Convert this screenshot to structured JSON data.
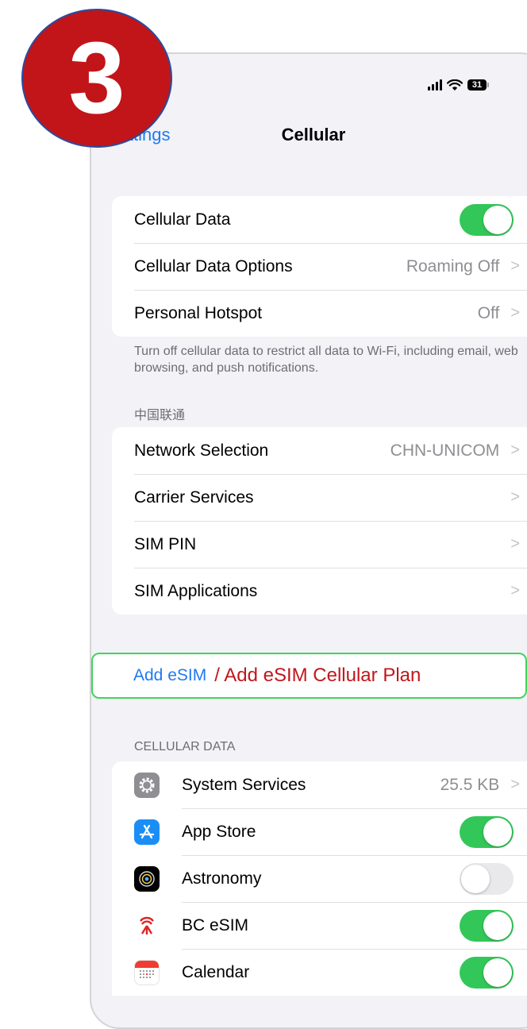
{
  "badge": {
    "number": "3"
  },
  "status_bar": {
    "battery": "31"
  },
  "nav": {
    "back_label": "Settings",
    "title": "Cellular"
  },
  "main_group": [
    {
      "label": "Cellular Data",
      "toggle": true
    },
    {
      "label": "Cellular Data Options",
      "value": "Roaming Off"
    },
    {
      "label": "Personal Hotspot",
      "value": "Off"
    }
  ],
  "main_footer": "Turn off cellular data to restrict all data to Wi-Fi, including email, web browsing, and push notifications.",
  "carrier": {
    "header": "中国联通",
    "rows": [
      {
        "label": "Network Selection",
        "value": "CHN-UNICOM"
      },
      {
        "label": "Carrier Services",
        "value": ""
      },
      {
        "label": "SIM PIN",
        "value": ""
      },
      {
        "label": "SIM Applications",
        "value": ""
      }
    ]
  },
  "add_esim": {
    "label": "Add eSIM",
    "annotation": "/ Add eSIM Cellular Plan"
  },
  "cellular_data": {
    "header": "CELLULAR DATA",
    "apps": [
      {
        "name": "System Services",
        "value": "25.5 KB",
        "icon": "gear-icon"
      },
      {
        "name": "App Store",
        "toggle": true,
        "icon": "app-store-icon"
      },
      {
        "name": "Astronomy",
        "toggle": false,
        "icon": "astronomy-icon"
      },
      {
        "name": "BC eSIM",
        "toggle": true,
        "icon": "bc-esim-icon"
      },
      {
        "name": "Calendar",
        "toggle": true,
        "icon": "calendar-icon"
      }
    ]
  },
  "colors": {
    "accent": "#1f7aef",
    "toggle_on": "#33c759",
    "annotation": "#c0171c",
    "highlight_border": "#3fd55a"
  }
}
